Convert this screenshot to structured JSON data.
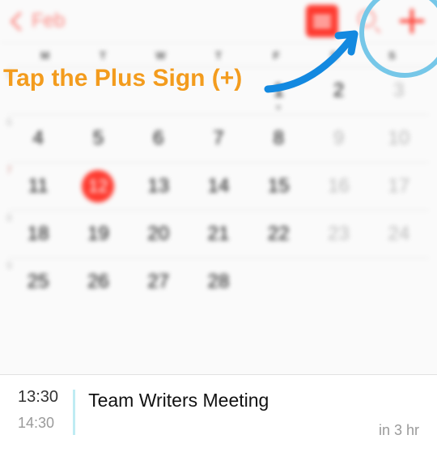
{
  "annotation": {
    "caption": "Tap the Plus Sign (+)"
  },
  "nav": {
    "back_label": "Feb"
  },
  "dow": [
    "M",
    "T",
    "W",
    "T",
    "F",
    "S",
    "S"
  ],
  "weeks": [
    {
      "wk": "5",
      "wk_red": false,
      "days": [
        {
          "n": "",
          "dim": false
        },
        {
          "n": "",
          "dim": false
        },
        {
          "n": "",
          "dim": false
        },
        {
          "n": "",
          "dim": false
        },
        {
          "n": "1",
          "dim": false,
          "dot": true
        },
        {
          "n": "2",
          "dim": false
        },
        {
          "n": "3",
          "dim": true
        }
      ]
    },
    {
      "wk": "6",
      "wk_red": false,
      "days": [
        {
          "n": "4"
        },
        {
          "n": "5"
        },
        {
          "n": "6"
        },
        {
          "n": "7"
        },
        {
          "n": "8"
        },
        {
          "n": "9",
          "dim": true
        },
        {
          "n": "10",
          "dim": true
        }
      ]
    },
    {
      "wk": "7",
      "wk_red": true,
      "days": [
        {
          "n": "11"
        },
        {
          "n": "12",
          "selected": true
        },
        {
          "n": "13"
        },
        {
          "n": "14"
        },
        {
          "n": "15"
        },
        {
          "n": "16",
          "dim": true
        },
        {
          "n": "17",
          "dim": true
        }
      ]
    },
    {
      "wk": "8",
      "wk_red": false,
      "days": [
        {
          "n": "18"
        },
        {
          "n": "19"
        },
        {
          "n": "20"
        },
        {
          "n": "21"
        },
        {
          "n": "22"
        },
        {
          "n": "23",
          "dim": true
        },
        {
          "n": "24",
          "dim": true
        }
      ]
    },
    {
      "wk": "9",
      "wk_red": false,
      "days": [
        {
          "n": "25"
        },
        {
          "n": "26"
        },
        {
          "n": "27"
        },
        {
          "n": "28"
        },
        {
          "n": ""
        },
        {
          "n": ""
        },
        {
          "n": ""
        }
      ]
    }
  ],
  "event": {
    "start": "13:30",
    "end": "14:30",
    "title": "Team Writers Meeting",
    "relative": "in 3 hr"
  }
}
